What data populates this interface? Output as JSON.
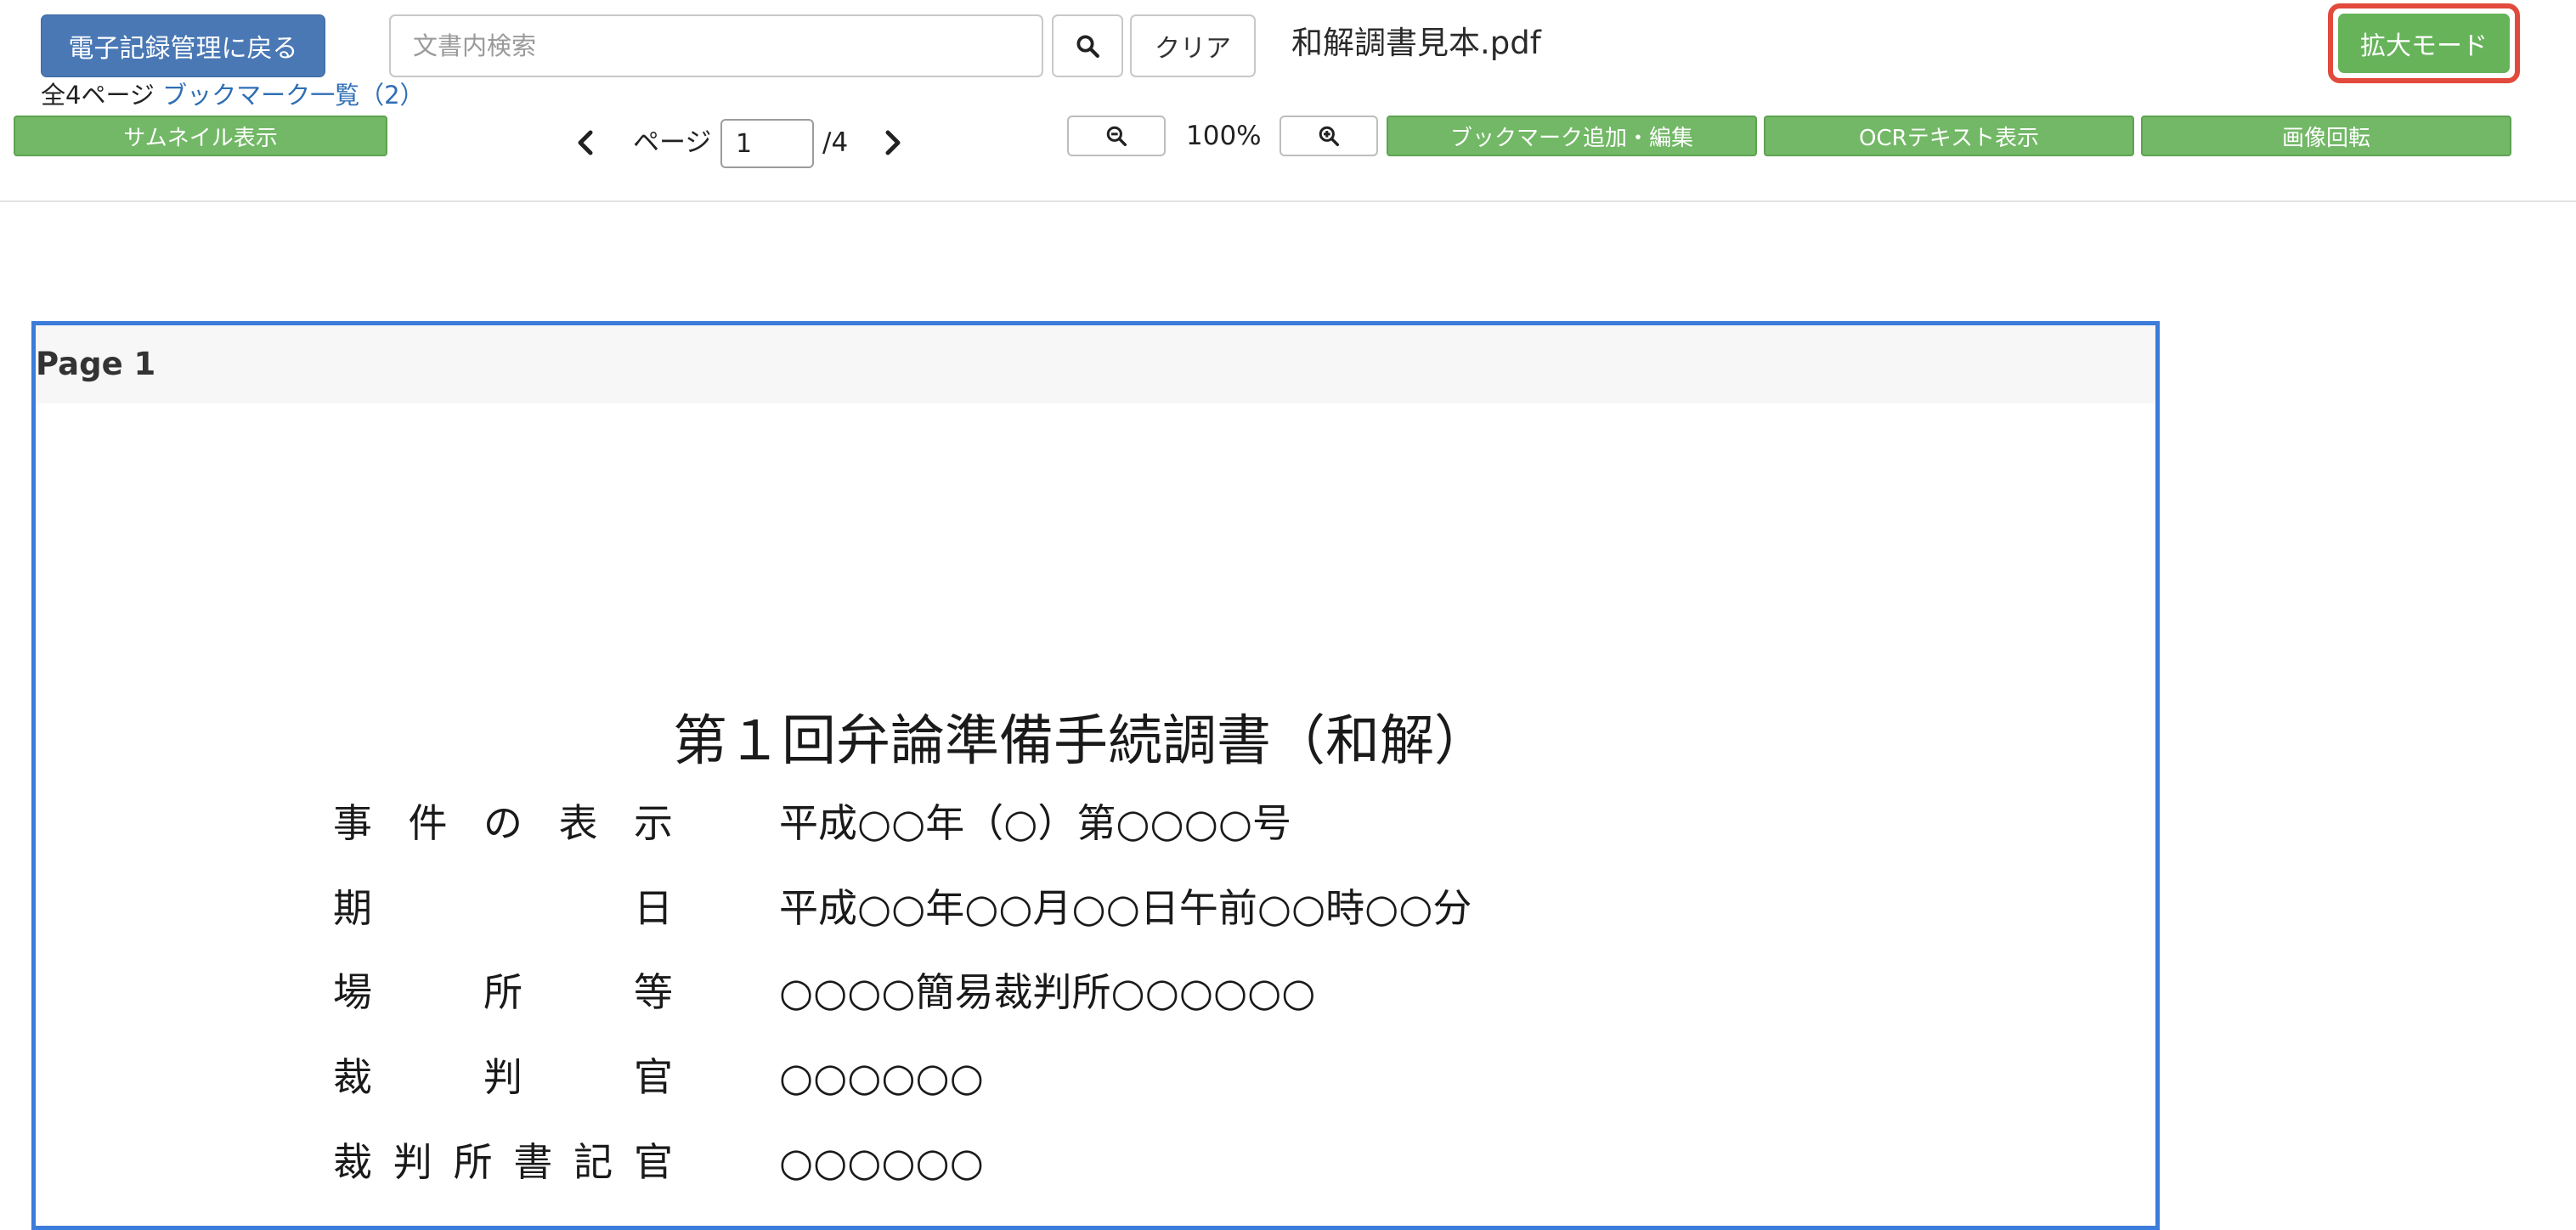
{
  "header": {
    "back_button": "電子記録管理に戻る",
    "search_placeholder": "文書内検索",
    "clear_button": "クリア",
    "document_title": "和解調書見本.pdf",
    "expand_button": "拡大モード"
  },
  "info": {
    "total_pages": "全4ページ",
    "bookmark_link": "ブックマーク一覧（2）"
  },
  "toolbar": {
    "thumbnail_button": "サムネイル表示",
    "page_label": "ページ",
    "current_page": "1",
    "total_pages": "/4",
    "zoom_level": "100%",
    "bookmark_button": "ブックマーク追加・編集",
    "ocr_button": "OCRテキスト表示",
    "rotate_button": "画像回転"
  },
  "viewer": {
    "page_header": "Page 1",
    "heading": "第１回弁論準備手続調書（和解）",
    "fields": [
      {
        "label": "事件の表示",
        "value": "平成○○年（○）第○○○○号"
      },
      {
        "label": "期日",
        "value": "平成○○年○○月○○日午前○○時○○分"
      },
      {
        "label": "場所等",
        "value": "○○○○簡易裁判所○○○○○○"
      },
      {
        "label": "裁判官",
        "value": "○○○○○○"
      },
      {
        "label": "裁判所書記官",
        "value": "○○○○○○"
      }
    ]
  },
  "colors": {
    "primary": "#4a78b5",
    "green": "#72b866",
    "highlight": "#e24a3b",
    "page_border": "#3b7bd9",
    "link": "#2f6fb5"
  }
}
